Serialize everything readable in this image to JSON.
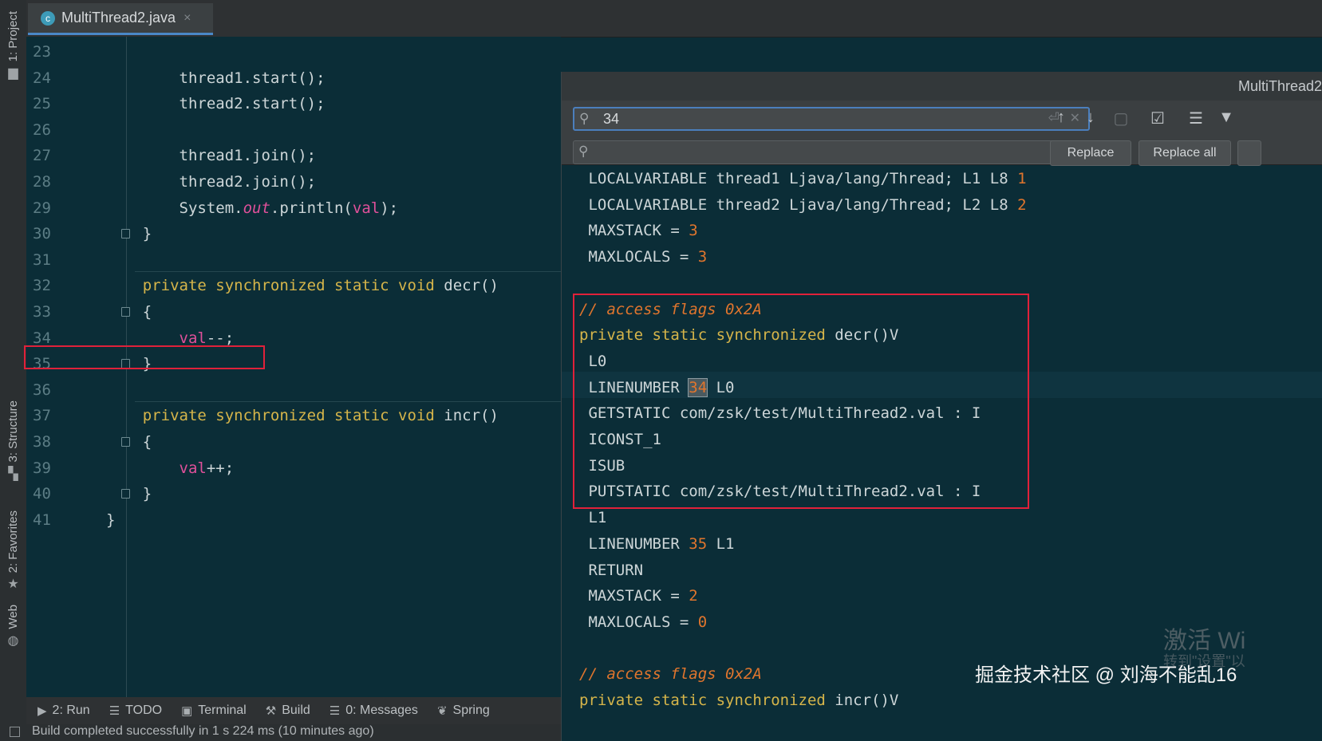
{
  "tool_windows": {
    "project": "1: Project",
    "structure": "3: Structure",
    "favorites": "2: Favorites",
    "web": "Web"
  },
  "tab": {
    "file_name": "MultiThread2.java",
    "icon": "class-c-icon",
    "close": "×"
  },
  "editor": {
    "lines": [
      {
        "n": "23",
        "parts": []
      },
      {
        "n": "24",
        "parts": [
          {
            "t": "        thread1.start();"
          }
        ]
      },
      {
        "n": "25",
        "parts": [
          {
            "t": "        thread2.start();"
          }
        ]
      },
      {
        "n": "26",
        "parts": []
      },
      {
        "n": "27",
        "parts": [
          {
            "t": "        thread1.join();"
          }
        ]
      },
      {
        "n": "28",
        "parts": [
          {
            "t": "        thread2.join();"
          }
        ]
      },
      {
        "n": "29",
        "parts": [
          {
            "t": "        System."
          },
          {
            "t": "out",
            "c": "italic-field"
          },
          {
            "t": ".println("
          },
          {
            "t": "val",
            "c": "field"
          },
          {
            "t": ");"
          }
        ]
      },
      {
        "n": "30",
        "parts": [
          {
            "t": "    }"
          }
        ]
      },
      {
        "n": "31",
        "parts": []
      },
      {
        "n": "32",
        "parts": [
          {
            "t": "    "
          },
          {
            "t": "private synchronized static void",
            "c": "kw"
          },
          {
            "t": " decr()"
          }
        ]
      },
      {
        "n": "33",
        "parts": [
          {
            "t": "    {"
          }
        ]
      },
      {
        "n": "34",
        "parts": [
          {
            "t": "        "
          },
          {
            "t": "val",
            "c": "field"
          },
          {
            "t": "--;"
          }
        ]
      },
      {
        "n": "35",
        "parts": [
          {
            "t": "    }"
          }
        ]
      },
      {
        "n": "36",
        "parts": []
      },
      {
        "n": "37",
        "parts": [
          {
            "t": "    "
          },
          {
            "t": "private synchronized static void",
            "c": "kw"
          },
          {
            "t": " incr()"
          }
        ]
      },
      {
        "n": "38",
        "parts": [
          {
            "t": "    {"
          }
        ]
      },
      {
        "n": "39",
        "parts": [
          {
            "t": "        "
          },
          {
            "t": "val",
            "c": "field"
          },
          {
            "t": "++;"
          }
        ]
      },
      {
        "n": "40",
        "parts": [
          {
            "t": "    }"
          }
        ]
      },
      {
        "n": "41",
        "parts": [
          {
            "t": "}"
          }
        ]
      }
    ]
  },
  "bytecode": {
    "title": "MultiThread2",
    "search": {
      "query": "34",
      "replace": "",
      "replace_label": "Replace",
      "replace_all_label": "Replace all"
    },
    "lines": [
      [
        {
          "t": " LOCALVARIABLE thread1 Ljava/lang/Thread; L1 L8 "
        },
        {
          "t": "1",
          "c": "num"
        }
      ],
      [
        {
          "t": " LOCALVARIABLE thread2 Ljava/lang/Thread; L2 L8 "
        },
        {
          "t": "2",
          "c": "num"
        }
      ],
      [
        {
          "t": " MAXSTACK = "
        },
        {
          "t": "3",
          "c": "num"
        }
      ],
      [
        {
          "t": " MAXLOCALS = "
        },
        {
          "t": "3",
          "c": "num"
        }
      ],
      [],
      [
        {
          "t": "// access flags 0x2A",
          "c": "cmt"
        }
      ],
      [
        {
          "t": "private static synchronized",
          "c": "kw"
        },
        {
          "t": " decr()V"
        }
      ],
      [
        {
          "t": " L0"
        }
      ],
      [
        {
          "t": " LINENUMBER "
        },
        {
          "t": "34",
          "c": "num match"
        },
        {
          "t": " L0"
        }
      ],
      [
        {
          "t": " GETSTATIC com/zsk/test/MultiThread2.val : I"
        }
      ],
      [
        {
          "t": " ICONST_1"
        }
      ],
      [
        {
          "t": " ISUB"
        }
      ],
      [
        {
          "t": " PUTSTATIC com/zsk/test/MultiThread2.val : I"
        }
      ],
      [
        {
          "t": " L1"
        }
      ],
      [
        {
          "t": " LINENUMBER "
        },
        {
          "t": "35",
          "c": "num"
        },
        {
          "t": " L1"
        }
      ],
      [
        {
          "t": " RETURN"
        }
      ],
      [
        {
          "t": " MAXSTACK = "
        },
        {
          "t": "2",
          "c": "num"
        }
      ],
      [
        {
          "t": " MAXLOCALS = "
        },
        {
          "t": "0",
          "c": "num"
        }
      ],
      [],
      [
        {
          "t": "// access flags 0x2A",
          "c": "cmt"
        }
      ],
      [
        {
          "t": "private static synchronized",
          "c": "kw"
        },
        {
          "t": " incr()V"
        }
      ]
    ]
  },
  "bottom_tools": [
    {
      "label": "2: Run",
      "icon": "play-icon",
      "glyph": "▶"
    },
    {
      "label": "TODO",
      "icon": "list-icon",
      "glyph": "☰"
    },
    {
      "label": "Terminal",
      "icon": "terminal-icon",
      "glyph": "▣"
    },
    {
      "label": "Build",
      "icon": "hammer-icon",
      "glyph": "⚒"
    },
    {
      "label": "0: Messages",
      "icon": "messages-icon",
      "glyph": "☰"
    },
    {
      "label": "Spring",
      "icon": "spring-icon",
      "glyph": "❦"
    }
  ],
  "status": "Build completed successfully in 1 s 224 ms (10 minutes ago)",
  "watermark": {
    "windows": "激活 Wi",
    "windows_sub": "转到\"设置\"以",
    "credit": "掘金技术社区 @ 刘海不能乱16"
  }
}
